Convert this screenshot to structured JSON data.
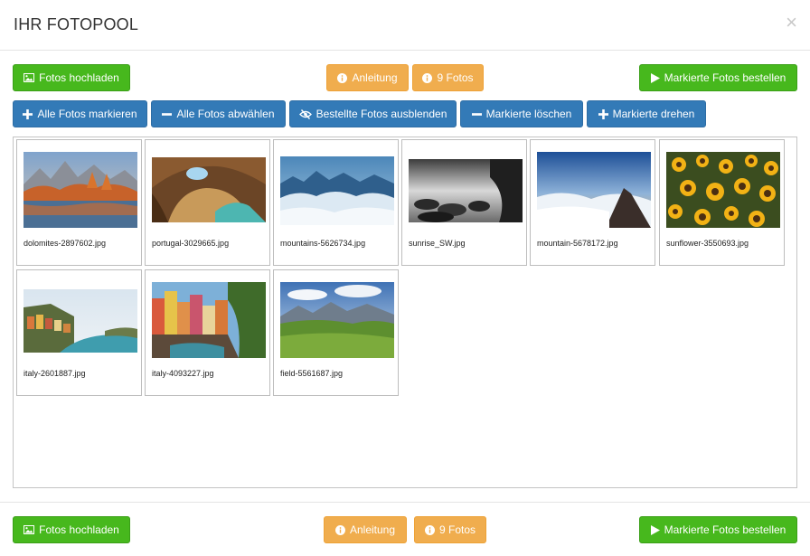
{
  "modal": {
    "title": "IHR FOTOPOOL",
    "close_symbol": "×"
  },
  "toolbar_top": {
    "upload_label": "Fotos hochladen",
    "guide_label": "Anleitung",
    "count_label": "9 Fotos",
    "order_label": "Markierte Fotos bestellen"
  },
  "selection_bar": {
    "mark_all": "Alle Fotos markieren",
    "unmark_all": "Alle Fotos abwählen",
    "hide_ordered": "Bestellte Fotos ausblenden",
    "delete_marked": "Markierte löschen",
    "rotate_marked": "Markierte drehen"
  },
  "photos": [
    {
      "filename": "dolomites-2897602.jpg"
    },
    {
      "filename": "portugal-3029665.jpg"
    },
    {
      "filename": "mountains-5626734.jpg"
    },
    {
      "filename": "sunrise_SW.jpg"
    },
    {
      "filename": "mountain-5678172.jpg"
    },
    {
      "filename": "sunflower-3550693.jpg"
    },
    {
      "filename": "italy-2601887.jpg"
    },
    {
      "filename": "italy-4093227.jpg"
    },
    {
      "filename": "field-5561687.jpg"
    }
  ],
  "toolbar_bottom": {
    "upload_label": "Fotos hochladen",
    "guide_label": "Anleitung",
    "count_label": "9 Fotos",
    "order_label": "Markierte Fotos bestellen"
  },
  "colors": {
    "green": "#47b81d",
    "orange": "#f0ad4e",
    "blue": "#337ab7"
  }
}
